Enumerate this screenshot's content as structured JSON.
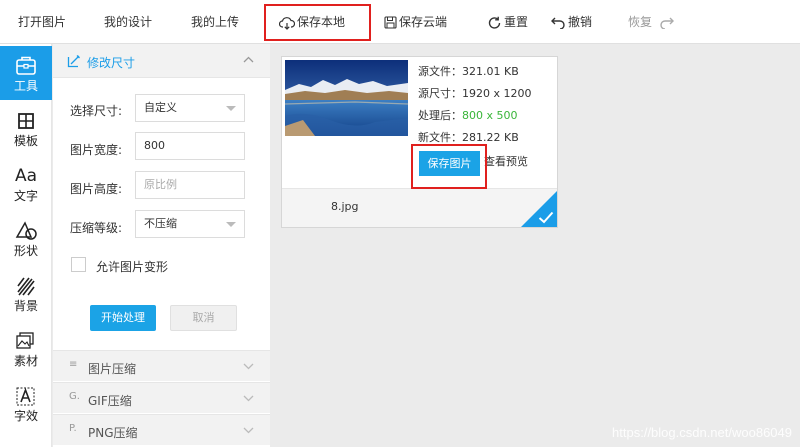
{
  "toolbar": {
    "open_image": "打开图片",
    "my_designs": "我的设计",
    "my_uploads": "我的上传",
    "save_local": "保存本地",
    "save_cloud": "保存云端",
    "reset": "重置",
    "undo": "撤销",
    "redo": "恢复"
  },
  "nav": {
    "tools": "工具",
    "templates": "模板",
    "text_icon": "Aa",
    "text": "文字",
    "shapes": "形状",
    "background": "背景",
    "materials": "素材",
    "font_effects": "字效"
  },
  "panel": {
    "title": "修改尺寸",
    "size_label": "选择尺寸:",
    "size_value": "自定义",
    "width_label": "图片宽度:",
    "width_value": "800",
    "height_label": "图片高度:",
    "height_placeholder": "原比例",
    "compress_label": "压缩等级:",
    "compress_value": "不压缩",
    "allow_deform": "允许图片变形",
    "start_button": "开始处理",
    "cancel_button": "取消",
    "accordion": [
      {
        "icon": "≡",
        "label": "图片压缩"
      },
      {
        "icon": "G.",
        "label": "GIF压缩"
      },
      {
        "icon": "P.",
        "label": "PNG压缩"
      }
    ]
  },
  "card": {
    "src_file": "源文件：321.01 KB",
    "src_size": "源尺寸：1920 x 1200",
    "processed_label": "处理后：",
    "processed_value": "800 x 500",
    "new_file": "新文件：281.22 KB",
    "save_button": "保存图片",
    "preview": "查看预览",
    "filename": "8.jpg"
  },
  "watermark": "https://blog.csdn.net/woo86049",
  "colors": {
    "accent": "#1b9de8",
    "highlight": "#e0201e",
    "green": "#3ab53a"
  }
}
